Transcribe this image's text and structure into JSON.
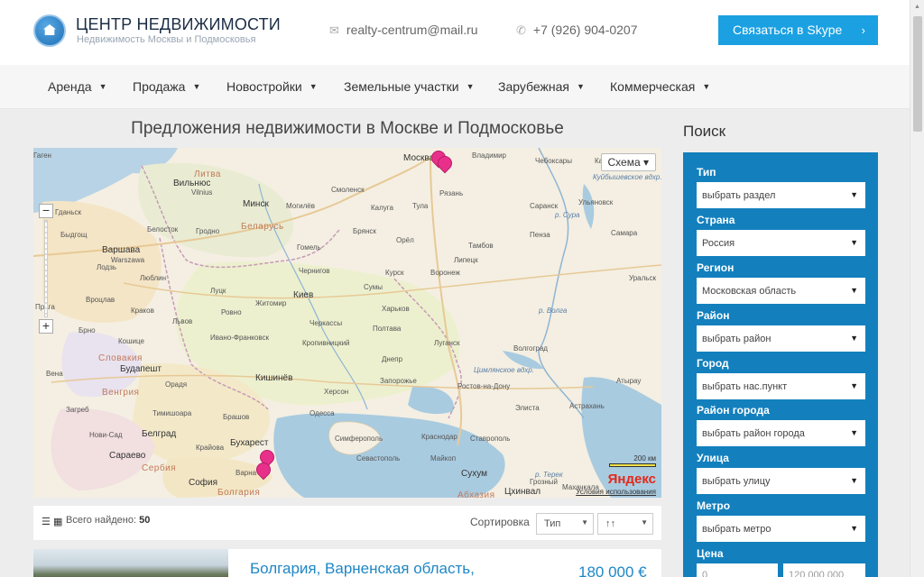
{
  "header": {
    "brand_title": "ЦЕНТР НЕДВИЖИМОСТИ",
    "brand_subtitle": "Недвижимость Москвы и Подмосковья",
    "email": "realty-centrum@mail.ru",
    "phone": "+7 (926) 904-0207",
    "skype_button": "Связаться в Skype"
  },
  "nav": {
    "items": [
      {
        "label": "Аренда"
      },
      {
        "label": "Продажа"
      },
      {
        "label": "Новостройки"
      },
      {
        "label": "Земельные участки"
      },
      {
        "label": "Зарубежная"
      },
      {
        "label": "Коммерческая"
      }
    ]
  },
  "main": {
    "title": "Предложения недвижимости в Москве и Подмосковье"
  },
  "map": {
    "scheme_button": "Схема ▾",
    "scale_label": "200 км",
    "provider": "Яндекс",
    "terms_link": "Условия использования",
    "zoom_in": "+",
    "zoom_out": "−",
    "labels": {
      "moscow": "Москва",
      "vladimir": "Владимир",
      "cheboksary": "Чебоксары",
      "kazan": "Казань",
      "smolensk": "Смоленск",
      "kaluga": "Калуга",
      "tula": "Тула",
      "ryazan": "Рязань",
      "minsk": "Минск",
      "mogilev": "Могилёв",
      "belarus": "Беларусь",
      "vilnius": "Вильнюс",
      "vilnius_lat": "Vilnius",
      "litva": "Литва",
      "gdansk": "Гданьск",
      "bydgoszcz": "Быдгощ",
      "belostok": "Белосток",
      "grodno": "Гродно",
      "varshava": "Варшава",
      "varshava_lat": "Warszawa",
      "lodz": "Лодзь",
      "lublin": "Люблин",
      "bryansk": "Брянск",
      "orel": "Орёл",
      "tambov": "Тамбов",
      "lipetsk": "Липецк",
      "saransk": "Саранск",
      "penza": "Пенза",
      "ulyanovsk": "Ульяновск",
      "samara": "Самара",
      "gomel": "Гомель",
      "chernigov": "Чернигов",
      "kursk": "Курск",
      "voronezh": "Воронеж",
      "kiev": "Киев",
      "sumy": "Сумы",
      "kharkov": "Харьков",
      "lutsk": "Луцк",
      "rovno": "Ровно",
      "zhitomir": "Житомир",
      "vroclav": "Вроцлав",
      "krakov": "Краков",
      "lvov": "Львов",
      "praga": "Прага",
      "brno": "Брно",
      "kosice": "Кошице",
      "ivano_frankovsk": "Ивано-Франковск",
      "cherkassy": "Черкассы",
      "poltava": "Полтава",
      "kropivnitsky": "Кропивницкий",
      "lugansk": "Луганск",
      "volgograd": "Волгоград",
      "uralsk": "Уральск",
      "slovakia": "Словакия",
      "vena": "Вена",
      "budapesht": "Будапешт",
      "vengria": "Венгрия",
      "dnepr": "Днепр",
      "zaporozhye": "Запорожье",
      "kishinev": "Кишинёв",
      "rostov": "Ростов-на-Дону",
      "herson": "Херсон",
      "zagreb": "Загреб",
      "oradea": "Орадя",
      "timisoara": "Тимишоара",
      "brashov": "Брашов",
      "odessa": "Одесса",
      "elista": "Элиста",
      "astrakhan": "Астрахань",
      "atyrau": "Атырау",
      "novisad": "Нови-Сад",
      "belgrad": "Белград",
      "simferopol": "Симферополь",
      "krasnodar": "Краснодар",
      "stavropol": "Ставрополь",
      "sarajevo": "Сараево",
      "serbia": "Сербия",
      "krayova": "Крайова",
      "buharest": "Бухарест",
      "sevastopol": "Севастополь",
      "maikop": "Майкоп",
      "sofia": "София",
      "varna": "Варна",
      "bolgaria": "Болгария",
      "suhum": "Сухум",
      "abhazia": "Абхазия",
      "tshinval": "Цхинвал",
      "grozny": "Грозный",
      "makhachkala": "Махачкала",
      "kuibyshev": "Куйбышевское вдхр.",
      "tsimlyansk": "Цимлянское вдхр.",
      "volga": "р. Волга",
      "sura": "р. Сура",
      "terek": "р. Терек",
      "gagen": "Гаген"
    }
  },
  "results": {
    "found_label": "Всего найдено:",
    "found_count": "50",
    "sort_label": "Сортировка",
    "sort_field": "Тип",
    "sort_order": "↑↑"
  },
  "listing": {
    "title": "Болгария, Варненская область,",
    "price": "180 000 €"
  },
  "sidebar": {
    "title": "Поиск",
    "fields": [
      {
        "label": "Тип",
        "value": "выбрать раздел"
      },
      {
        "label": "Страна",
        "value": "Россия"
      },
      {
        "label": "Регион",
        "value": "Московская область"
      },
      {
        "label": "Район",
        "value": "выбрать район"
      },
      {
        "label": "Город",
        "value": "выбрать нас.пункт"
      },
      {
        "label": "Район города",
        "value": "выбрать район города"
      },
      {
        "label": "Улица",
        "value": "выбрать улицу"
      },
      {
        "label": "Метро",
        "value": "выбрать метро"
      }
    ],
    "price_label": "Цена",
    "price_from": "0",
    "price_to": "120 000 000"
  },
  "colors": {
    "accent": "#1ba1e2",
    "panel": "#1380bd",
    "link": "#1f87c6"
  }
}
